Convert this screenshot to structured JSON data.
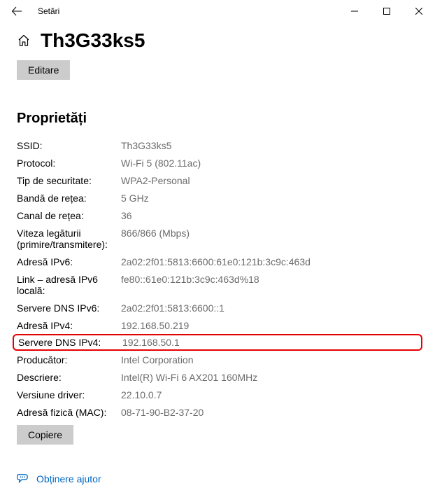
{
  "window": {
    "title": "Setări"
  },
  "page": {
    "title": "Th3G33ks5",
    "edit_button": "Editare",
    "properties_heading": "Proprietăți",
    "copy_button": "Copiere"
  },
  "properties": [
    {
      "label": "SSID:",
      "value": "Th3G33ks5"
    },
    {
      "label": "Protocol:",
      "value": "Wi-Fi 5 (802.11ac)"
    },
    {
      "label": "Tip de securitate:",
      "value": "WPA2-Personal"
    },
    {
      "label": "Bandă de rețea:",
      "value": "5 GHz"
    },
    {
      "label": "Canal de rețea:",
      "value": "36"
    },
    {
      "label": "Viteza legăturii (primire/transmitere):",
      "value": "866/866 (Mbps)"
    },
    {
      "label": "Adresă IPv6:",
      "value": "2a02:2f01:5813:6600:61e0:121b:3c9c:463d"
    },
    {
      "label": "Link – adresă IPv6 locală:",
      "value": "fe80::61e0:121b:3c9c:463d%18"
    },
    {
      "label": "Servere DNS IPv6:",
      "value": "2a02:2f01:5813:6600::1"
    },
    {
      "label": "Adresă IPv4:",
      "value": "192.168.50.219"
    },
    {
      "label": "Servere DNS IPv4:",
      "value": "192.168.50.1",
      "highlight": true
    },
    {
      "label": "Producător:",
      "value": "Intel Corporation"
    },
    {
      "label": "Descriere:",
      "value": "Intel(R) Wi-Fi 6 AX201 160MHz"
    },
    {
      "label": "Versiune driver:",
      "value": "22.10.0.7"
    },
    {
      "label": "Adresă fizică (MAC):",
      "value": "08-71-90-B2-37-20"
    }
  ],
  "help": {
    "text": "Obținere ajutor"
  }
}
